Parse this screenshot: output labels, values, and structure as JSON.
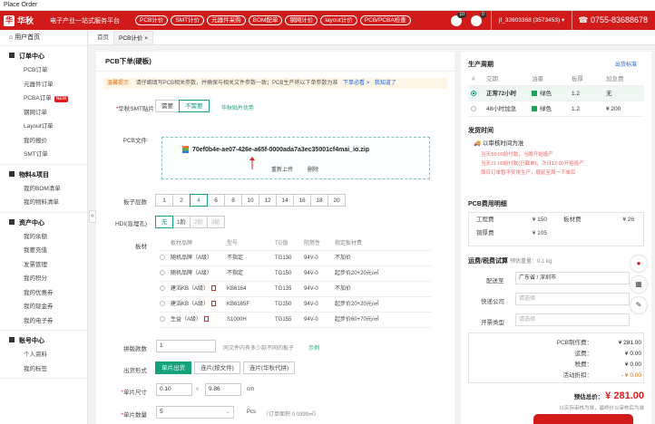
{
  "window_title": "Place Order",
  "header": {
    "logo_mark": "华",
    "logo_text": "华秋",
    "slogan": "电子产业一站式服务平台",
    "nav": [
      "PCB计价",
      "SMT计价",
      "元器件采购",
      "BOM配单",
      "钢网计价",
      "layout计价",
      "PCB/PCBA检查"
    ],
    "msg_count": "10",
    "cart_count": "0",
    "user": "jf_32603368 (3573453)",
    "phone": "0755-83688678"
  },
  "sidebar": {
    "home": "用户首页",
    "groups": [
      {
        "title": "订单中心",
        "items": [
          "PCB订单",
          "元器件订单",
          "PCBA订单",
          "钢网订单",
          "Layout订单",
          "我的报价",
          "SMT订单"
        ]
      },
      {
        "title": "物料&项目",
        "items": [
          "我的BOM清单",
          "我的物料清单"
        ]
      },
      {
        "title": "资产中心",
        "items": [
          "我的余额",
          "我要充值",
          "发票管理",
          "我的积分",
          "我的优惠券",
          "我的现金券",
          "我的电子券"
        ]
      },
      {
        "title": "账号中心",
        "items": [
          "个人资料",
          "我的标签"
        ]
      }
    ],
    "new_badge": "NEW",
    "collapse": "«"
  },
  "tabs": [
    "首页",
    "PCB计价"
  ],
  "main": {
    "title": "PCB下单(硬板)",
    "notice_tag": "温馨提示",
    "notice_msg": "请仔细填写PCB相关参数，并确保与相关文件参数一致；PCB生产将以下单参数为准",
    "notice_link1": "下单必看 >",
    "notice_link2": "我知道了",
    "smt_label": "华秋SMT贴片",
    "smt_opts": [
      "需要",
      "不需要"
    ],
    "smt_link": "华秋贴片优势",
    "file_label": "PCB文件",
    "file_name": "70ef0b4e-ae07-426e-a65f-0000ada7a3ec35001cf4mai_io.zip",
    "reupload": "重新上传",
    "delete": "删除",
    "layers_label": "板子层数",
    "layers": [
      "1",
      "2",
      "4",
      "6",
      "8",
      "10",
      "12",
      "14",
      "16",
      "18",
      "20"
    ],
    "hdi_label": "HDI(盲埋孔)",
    "hdi_opts": [
      "无",
      "1阶",
      "2阶",
      "3阶"
    ],
    "material_label": "板材",
    "mat_head": [
      "板材品牌",
      "型号",
      "TG值",
      "阻燃性",
      "指定板材费"
    ],
    "mat_rows": [
      [
        "随机品牌（A级）",
        "不指定",
        "TG130",
        "94V-0",
        "不加价"
      ],
      [
        "随机品牌（A级）",
        "不指定",
        "TG150",
        "94V-0",
        "起步价20+20元/㎡"
      ],
      [
        "建滔KB（A级）",
        "KB6164",
        "TG135",
        "94V-0",
        "不加价"
      ],
      [
        "建滔KB（A级）",
        "KB6165F",
        "TG150",
        "94V-0",
        "起步价20+20元/㎡"
      ],
      [
        "生益（A级）",
        "S1000H",
        "TG155",
        "94V-0",
        "起步价60+70元/㎡"
      ]
    ],
    "panel_label": "拼版款数",
    "panel_value": "1",
    "panel_hint": "同文件内有多少款不同的板子",
    "panel_example": "示例",
    "ship_form_label": "出货形式",
    "ship_form_opts": [
      "单片出货",
      "连片(按文件)",
      "连片(华秋代拼)"
    ],
    "size_label": "单片尺寸",
    "size_w": "0.10",
    "size_x": "x",
    "size_h": "9.86",
    "size_unit": "cm",
    "qty_label": "单片数量",
    "qty_value": "5",
    "qty_unit": "Pcs",
    "qty_hint": "（订单面积 0.0399㎡）"
  },
  "side": {
    "lead_title": "生产周期",
    "lead_link": "出货标准",
    "lead_head": [
      "#",
      "交期",
      "油墨",
      "板厚",
      "加急费"
    ],
    "lead_rows": [
      [
        "正常72小时",
        "绿色",
        "1.2",
        "无"
      ],
      [
        "48小时加急",
        "绿色",
        "1.2",
        "¥ 200"
      ]
    ],
    "ship_title": "发货时间",
    "ship_main": "以审核时间为准",
    "ship_notes": [
      "当天18:00前付款，当晚开始投产",
      "当天21:00前付款(已截单)，次日12:00开始投产",
      "周日订单暂不安排生产，顺延至周一下单后"
    ],
    "fee_title": "PCB费用明细",
    "fees": [
      [
        "工程费",
        "¥ 150"
      ],
      [
        "板材费",
        "¥ 26"
      ],
      [
        "铜厚费",
        "¥ 105"
      ]
    ],
    "ship2_title": "运费/税费试算",
    "ship2_weight": "预估重量：0.1 kg",
    "to_label": "配送至",
    "to_value": "广东省 / 深圳市",
    "express_label": "快递公司",
    "express_ph": "请选择",
    "invoice_label": "开票类型",
    "invoice_ph": "请选择",
    "summary": [
      [
        "PCB制作费：",
        "¥ 281.00"
      ],
      [
        "运费：",
        "¥ 0.00"
      ],
      [
        "税费：",
        "¥ 0.00"
      ],
      [
        "活动折扣：",
        "- ¥ 0.00"
      ]
    ],
    "total_label": "预估总价：",
    "total_value": "¥ 281.00",
    "total_note": "以实际审核为准，最终价以审核后为准"
  },
  "colors": {
    "brand": "#d11a1a",
    "accent": "#12a37a"
  }
}
